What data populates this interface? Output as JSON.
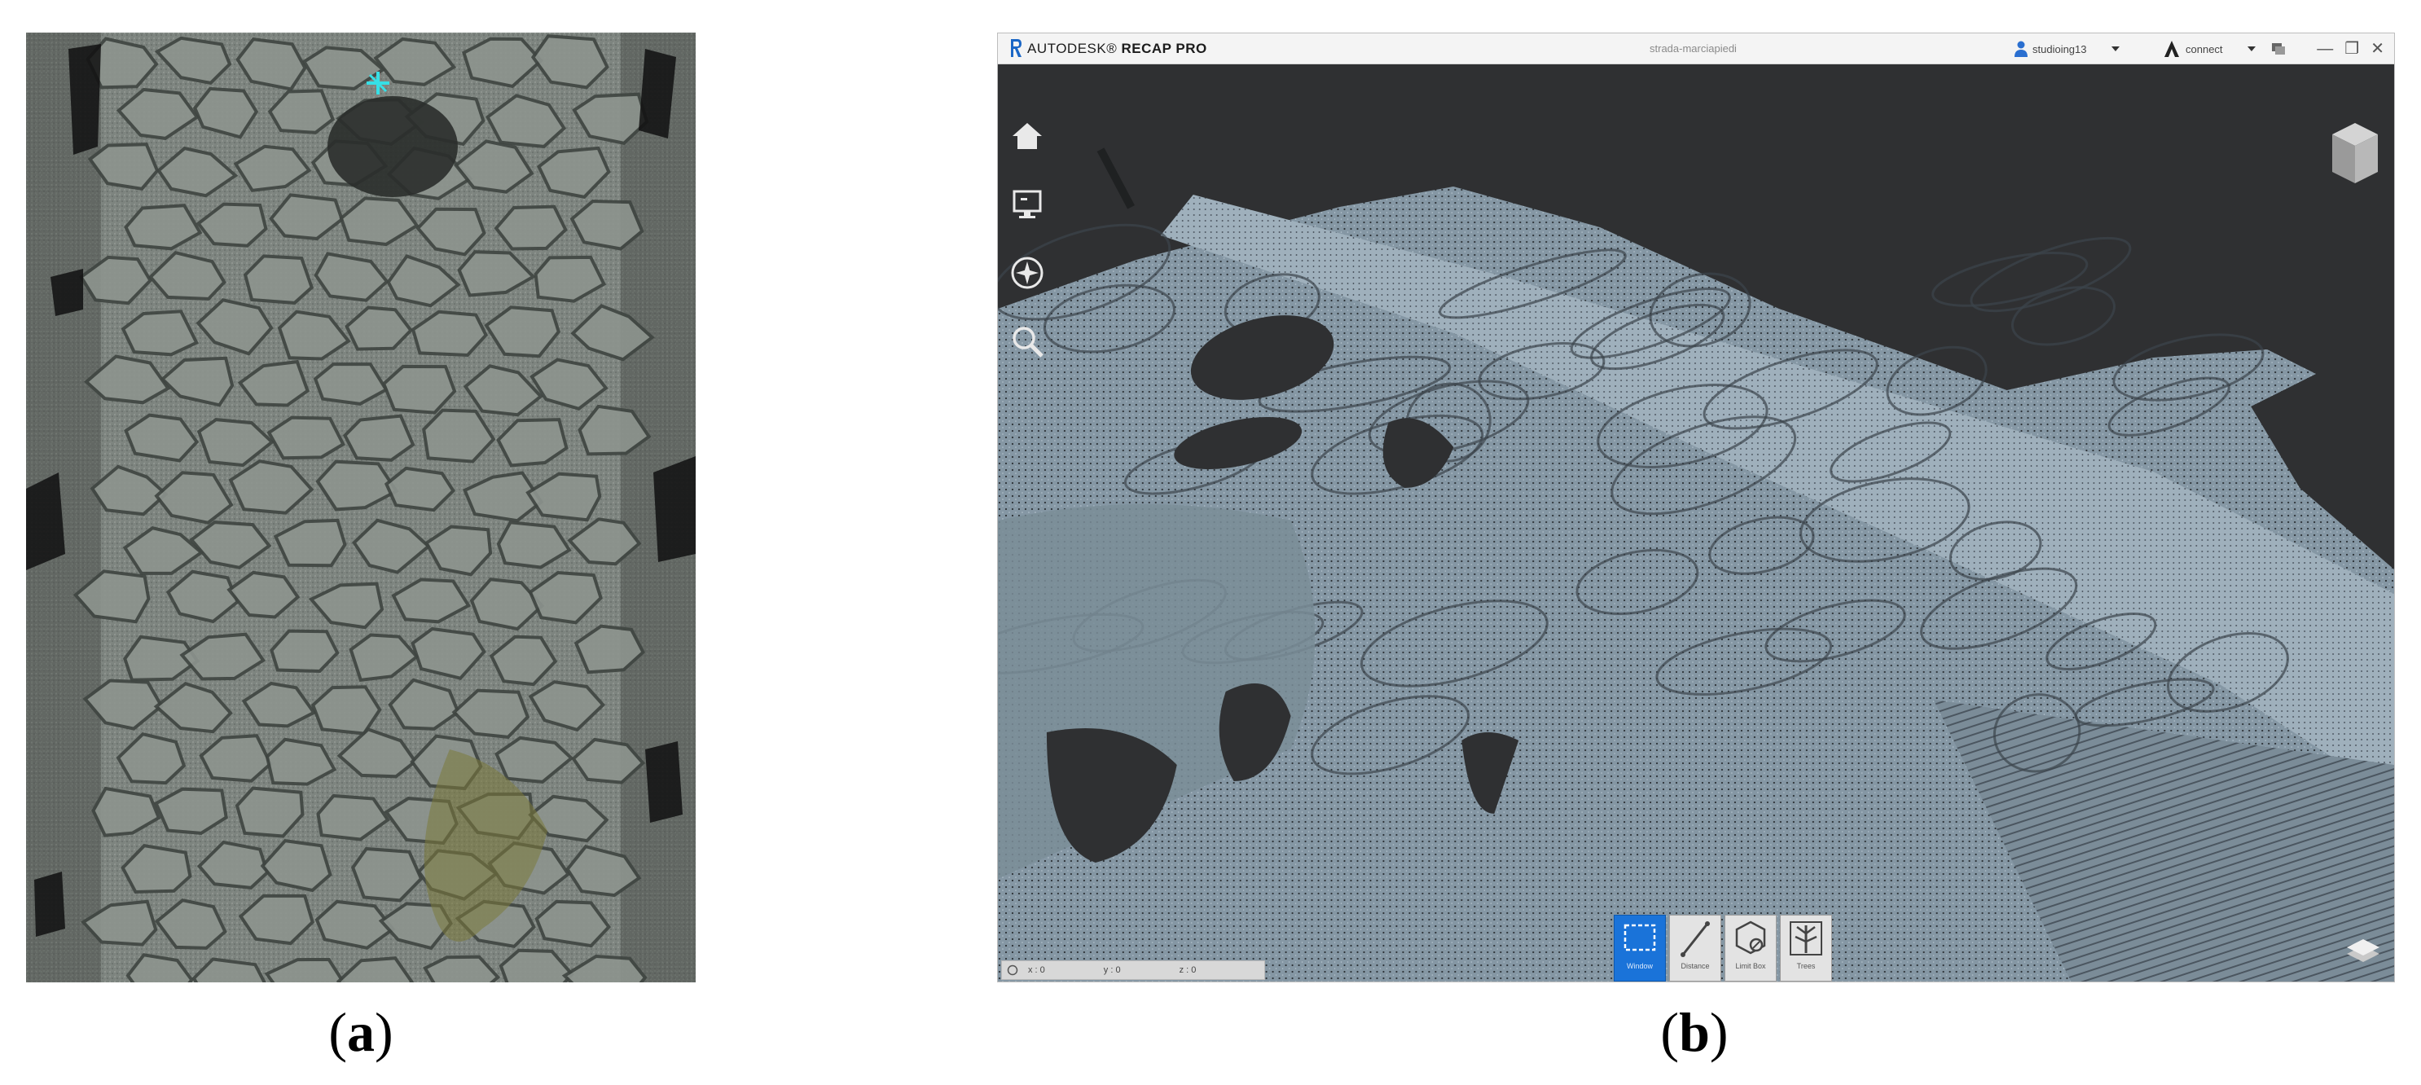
{
  "captions": {
    "a": {
      "paren_open": "(",
      "letter": "a",
      "paren_close": ")"
    },
    "b": {
      "paren_open": "(",
      "letter": "b",
      "paren_close": ")"
    }
  },
  "recap": {
    "brand_light": "AUTODESK",
    "brand_bold": "RECAP PRO",
    "doc_title": "strada-marciapiedi",
    "user_name": "studioing13",
    "connect_label": "connect",
    "window_controls": [
      "—",
      "❐",
      "✕"
    ],
    "nav_tools": [
      {
        "name": "home",
        "icon": "home-icon"
      },
      {
        "name": "display-settings",
        "icon": "monitor-icon"
      },
      {
        "name": "navigation",
        "icon": "compass-icon"
      },
      {
        "name": "zoom",
        "icon": "magnifier-icon"
      }
    ],
    "toolbar": [
      {
        "label": "Window",
        "icon": "window-select-icon",
        "active": true
      },
      {
        "label": "Distance",
        "icon": "distance-icon",
        "active": false
      },
      {
        "label": "Limit Box",
        "icon": "limit-box-icon",
        "active": false
      },
      {
        "label": "Trees",
        "icon": "trees-icon",
        "active": false
      }
    ],
    "status": {
      "x": "x : 0",
      "y": "y : 0",
      "z": "z : 0"
    },
    "colors": {
      "viewport_bg": "#2f3032",
      "point_cloud": "#8fa1ad",
      "active_tool": "#1a73d9",
      "titlebar": "#f4f4f4"
    }
  }
}
